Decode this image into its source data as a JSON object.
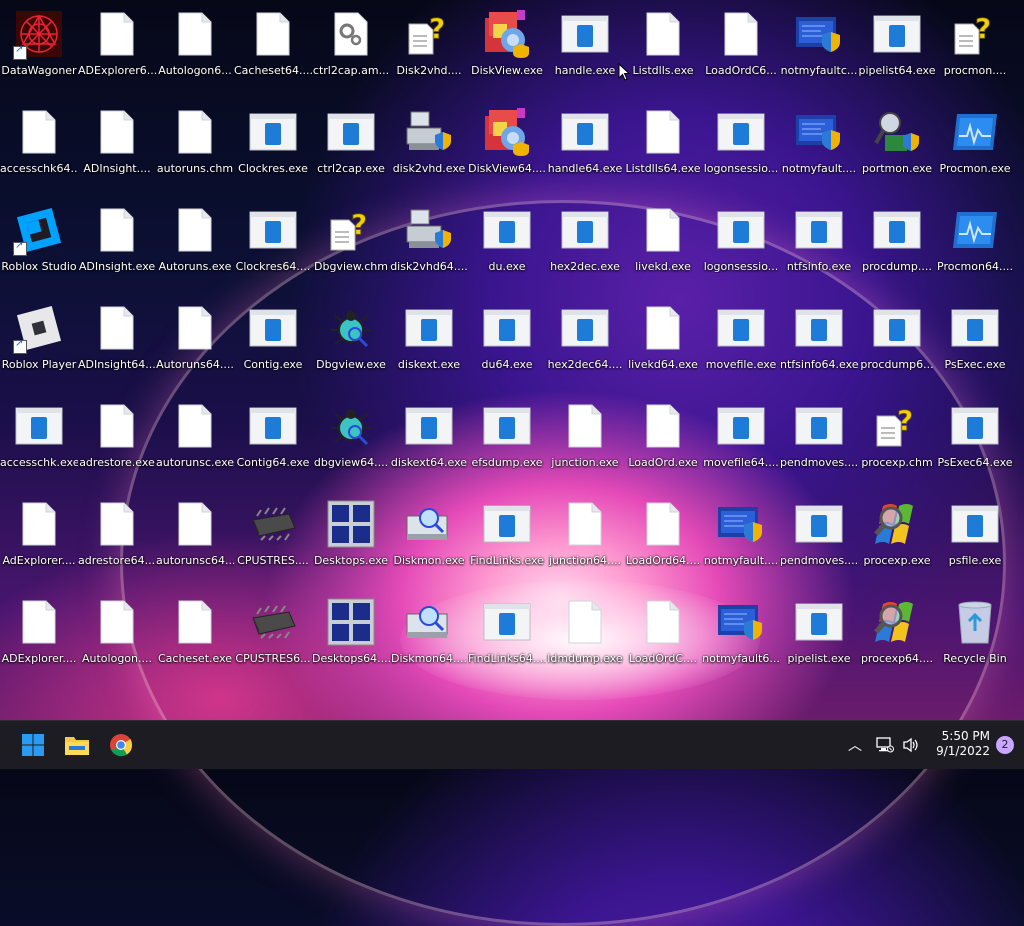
{
  "desktop": {
    "icons": [
      {
        "label": "DataWagoner",
        "type": "dw",
        "shortcut": true
      },
      {
        "label": "ADExplorer6...",
        "type": "doc"
      },
      {
        "label": "Autologon6...",
        "type": "doc"
      },
      {
        "label": "Cacheset64....",
        "type": "doc"
      },
      {
        "label": "ctrl2cap.am...",
        "type": "gear"
      },
      {
        "label": "Disk2vhd....",
        "type": "help"
      },
      {
        "label": "DiskView.exe",
        "type": "diskview"
      },
      {
        "label": "handle.exe",
        "type": "app"
      },
      {
        "label": "Listdlls.exe",
        "type": "doc"
      },
      {
        "label": "LoadOrdC6...",
        "type": "doc"
      },
      {
        "label": "notmyfaultc...",
        "type": "shield"
      },
      {
        "label": "pipelist64.exe",
        "type": "app"
      },
      {
        "label": "procmon....",
        "type": "help"
      },
      {
        "label": "accesschk64....",
        "type": "doc"
      },
      {
        "label": "ADInsight....",
        "type": "doc"
      },
      {
        "label": "autoruns.chm",
        "type": "doc"
      },
      {
        "label": "Clockres.exe",
        "type": "app"
      },
      {
        "label": "ctrl2cap.exe",
        "type": "app"
      },
      {
        "label": "disk2vhd.exe",
        "type": "disk"
      },
      {
        "label": "DiskView64....",
        "type": "diskview"
      },
      {
        "label": "handle64.exe",
        "type": "app"
      },
      {
        "label": "Listdlls64.exe",
        "type": "doc"
      },
      {
        "label": "logonsessio...",
        "type": "app"
      },
      {
        "label": "notmyfault....",
        "type": "shield"
      },
      {
        "label": "portmon.exe",
        "type": "portmon"
      },
      {
        "label": "Procmon.exe",
        "type": "procmon"
      },
      {
        "label": "Roblox Studio",
        "type": "roblox-studio",
        "shortcut": true
      },
      {
        "label": "ADInsight.exe",
        "type": "doc"
      },
      {
        "label": "Autoruns.exe",
        "type": "doc"
      },
      {
        "label": "Clockres64....",
        "type": "app"
      },
      {
        "label": "Dbgview.chm",
        "type": "help"
      },
      {
        "label": "disk2vhd64....",
        "type": "disk"
      },
      {
        "label": "du.exe",
        "type": "app"
      },
      {
        "label": "hex2dec.exe",
        "type": "app"
      },
      {
        "label": "livekd.exe",
        "type": "doc"
      },
      {
        "label": "logonsessio...",
        "type": "app"
      },
      {
        "label": "ntfsinfo.exe",
        "type": "app"
      },
      {
        "label": "procdump....",
        "type": "app"
      },
      {
        "label": "Procmon64....",
        "type": "procmon"
      },
      {
        "label": "Roblox Player",
        "type": "roblox-player",
        "shortcut": true
      },
      {
        "label": "ADInsight64....",
        "type": "doc"
      },
      {
        "label": "Autoruns64....",
        "type": "doc"
      },
      {
        "label": "Contig.exe",
        "type": "app"
      },
      {
        "label": "Dbgview.exe",
        "type": "bug"
      },
      {
        "label": "diskext.exe",
        "type": "app"
      },
      {
        "label": "du64.exe",
        "type": "app"
      },
      {
        "label": "hex2dec64....",
        "type": "app"
      },
      {
        "label": "livekd64.exe",
        "type": "doc"
      },
      {
        "label": "movefile.exe",
        "type": "app"
      },
      {
        "label": "ntfsinfo64.exe",
        "type": "app"
      },
      {
        "label": "procdump6...",
        "type": "app"
      },
      {
        "label": "PsExec.exe",
        "type": "app"
      },
      {
        "label": "accesschk.exe",
        "type": "app"
      },
      {
        "label": "adrestore.exe",
        "type": "doc"
      },
      {
        "label": "autorunsc.exe",
        "type": "doc"
      },
      {
        "label": "Contig64.exe",
        "type": "app"
      },
      {
        "label": "dbgview64....",
        "type": "bug"
      },
      {
        "label": "diskext64.exe",
        "type": "app"
      },
      {
        "label": "efsdump.exe",
        "type": "app"
      },
      {
        "label": "junction.exe",
        "type": "doc"
      },
      {
        "label": "LoadOrd.exe",
        "type": "doc"
      },
      {
        "label": "movefile64....",
        "type": "app"
      },
      {
        "label": "pendmoves....",
        "type": "app"
      },
      {
        "label": "procexp.chm",
        "type": "help"
      },
      {
        "label": "PsExec64.exe",
        "type": "app"
      },
      {
        "label": "AdExplorer....",
        "type": "doc"
      },
      {
        "label": "adrestore64....",
        "type": "doc"
      },
      {
        "label": "autorunsc64....",
        "type": "doc"
      },
      {
        "label": "CPUSTRES....",
        "type": "chip"
      },
      {
        "label": "Desktops.exe",
        "type": "desktops"
      },
      {
        "label": "Diskmon.exe",
        "type": "diskmon"
      },
      {
        "label": "FindLinks.exe",
        "type": "app"
      },
      {
        "label": "junction64....",
        "type": "doc"
      },
      {
        "label": "LoadOrd64....",
        "type": "doc"
      },
      {
        "label": "notmyfault....",
        "type": "shield"
      },
      {
        "label": "pendmoves....",
        "type": "app"
      },
      {
        "label": "procexp.exe",
        "type": "procexp"
      },
      {
        "label": "psfile.exe",
        "type": "app"
      },
      {
        "label": "ADExplorer....",
        "type": "doc"
      },
      {
        "label": "Autologon....",
        "type": "doc"
      },
      {
        "label": "Cacheset.exe",
        "type": "doc"
      },
      {
        "label": "CPUSTRES6...",
        "type": "chip"
      },
      {
        "label": "Desktops64....",
        "type": "desktops"
      },
      {
        "label": "Diskmon64....",
        "type": "diskmon"
      },
      {
        "label": "FindLinks64....",
        "type": "app"
      },
      {
        "label": "ldmdump.exe",
        "type": "doc"
      },
      {
        "label": "LoadOrdC....",
        "type": "doc"
      },
      {
        "label": "notmyfault6...",
        "type": "shield"
      },
      {
        "label": "pipelist.exe",
        "type": "app"
      },
      {
        "label": "procexp64....",
        "type": "procexp"
      },
      {
        "label": "Recycle Bin",
        "type": "bin"
      }
    ]
  },
  "taskbar": {
    "apps": [
      {
        "name": "start-button",
        "icon": "windows-logo-icon"
      },
      {
        "name": "file-explorer-button",
        "icon": "folder-icon"
      },
      {
        "name": "chrome-button",
        "icon": "chrome-icon"
      }
    ],
    "tray": {
      "time": "5:50 PM",
      "date": "9/1/2022",
      "notifications": "2"
    }
  },
  "colors": {
    "taskbar_bg": "#1c1c22",
    "accent": "#1e7bd8",
    "notification_badge": "#c9a6ff"
  }
}
